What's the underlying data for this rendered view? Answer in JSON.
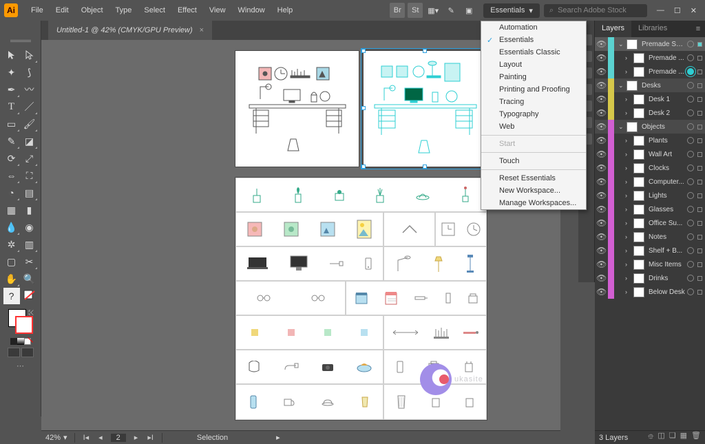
{
  "app": {
    "logo_text": "Ai"
  },
  "menu": [
    "File",
    "Edit",
    "Object",
    "Type",
    "Select",
    "Effect",
    "View",
    "Window",
    "Help"
  ],
  "workspace_switcher": "Essentials",
  "search": {
    "placeholder": "Search Adobe Stock"
  },
  "tab": {
    "title": "Untitled-1 @ 42% (CMYK/GPU Preview)"
  },
  "workspace_menu": {
    "items": [
      "Automation",
      "Essentials",
      "Essentials Classic",
      "Layout",
      "Painting",
      "Printing and Proofing",
      "Tracing",
      "Typography",
      "Web"
    ],
    "checked": "Essentials",
    "groups": [
      [
        "Start"
      ],
      [
        "Touch"
      ],
      [
        "Reset Essentials",
        "New Workspace...",
        "Manage Workspaces..."
      ]
    ],
    "disabled": [
      "Start"
    ]
  },
  "layers_panel": {
    "tabs": [
      "Layers",
      "Libraries"
    ],
    "active_tab": "Layers",
    "layers": [
      {
        "name": "Premade Scenes",
        "depth": 0,
        "open": true,
        "color": "cyan",
        "selected": true
      },
      {
        "name": "Premade ...",
        "depth": 1,
        "open": false,
        "color": "cyan"
      },
      {
        "name": "Premade ...",
        "depth": 1,
        "open": false,
        "color": "cyan",
        "target": true
      },
      {
        "name": "Desks",
        "depth": 0,
        "open": true,
        "color": "yellow"
      },
      {
        "name": "Desk 1",
        "depth": 1,
        "open": false,
        "color": "yellow"
      },
      {
        "name": "Desk 2",
        "depth": 1,
        "open": false,
        "color": "yellow"
      },
      {
        "name": "Objects",
        "depth": 0,
        "open": true,
        "color": "mag"
      },
      {
        "name": "Plants",
        "depth": 1,
        "open": false,
        "color": "mag"
      },
      {
        "name": "Wall Art",
        "depth": 1,
        "open": false,
        "color": "mag"
      },
      {
        "name": "Clocks",
        "depth": 1,
        "open": false,
        "color": "mag"
      },
      {
        "name": "Computer...",
        "depth": 1,
        "open": false,
        "color": "mag"
      },
      {
        "name": "Lights",
        "depth": 1,
        "open": false,
        "color": "mag"
      },
      {
        "name": "Glasses",
        "depth": 1,
        "open": false,
        "color": "mag"
      },
      {
        "name": "Office Su...",
        "depth": 1,
        "open": false,
        "color": "mag"
      },
      {
        "name": "Notes",
        "depth": 1,
        "open": false,
        "color": "mag"
      },
      {
        "name": "Shelf + B...",
        "depth": 1,
        "open": false,
        "color": "mag"
      },
      {
        "name": "Misc Items",
        "depth": 1,
        "open": false,
        "color": "mag"
      },
      {
        "name": "Drinks",
        "depth": 1,
        "open": false,
        "color": "mag"
      },
      {
        "name": "Below Desk",
        "depth": 1,
        "open": false,
        "color": "mag"
      }
    ],
    "status": "3 Layers"
  },
  "status": {
    "zoom": "42%",
    "artboard_nav": "2",
    "tool": "Selection"
  },
  "watermark": "ukasite"
}
